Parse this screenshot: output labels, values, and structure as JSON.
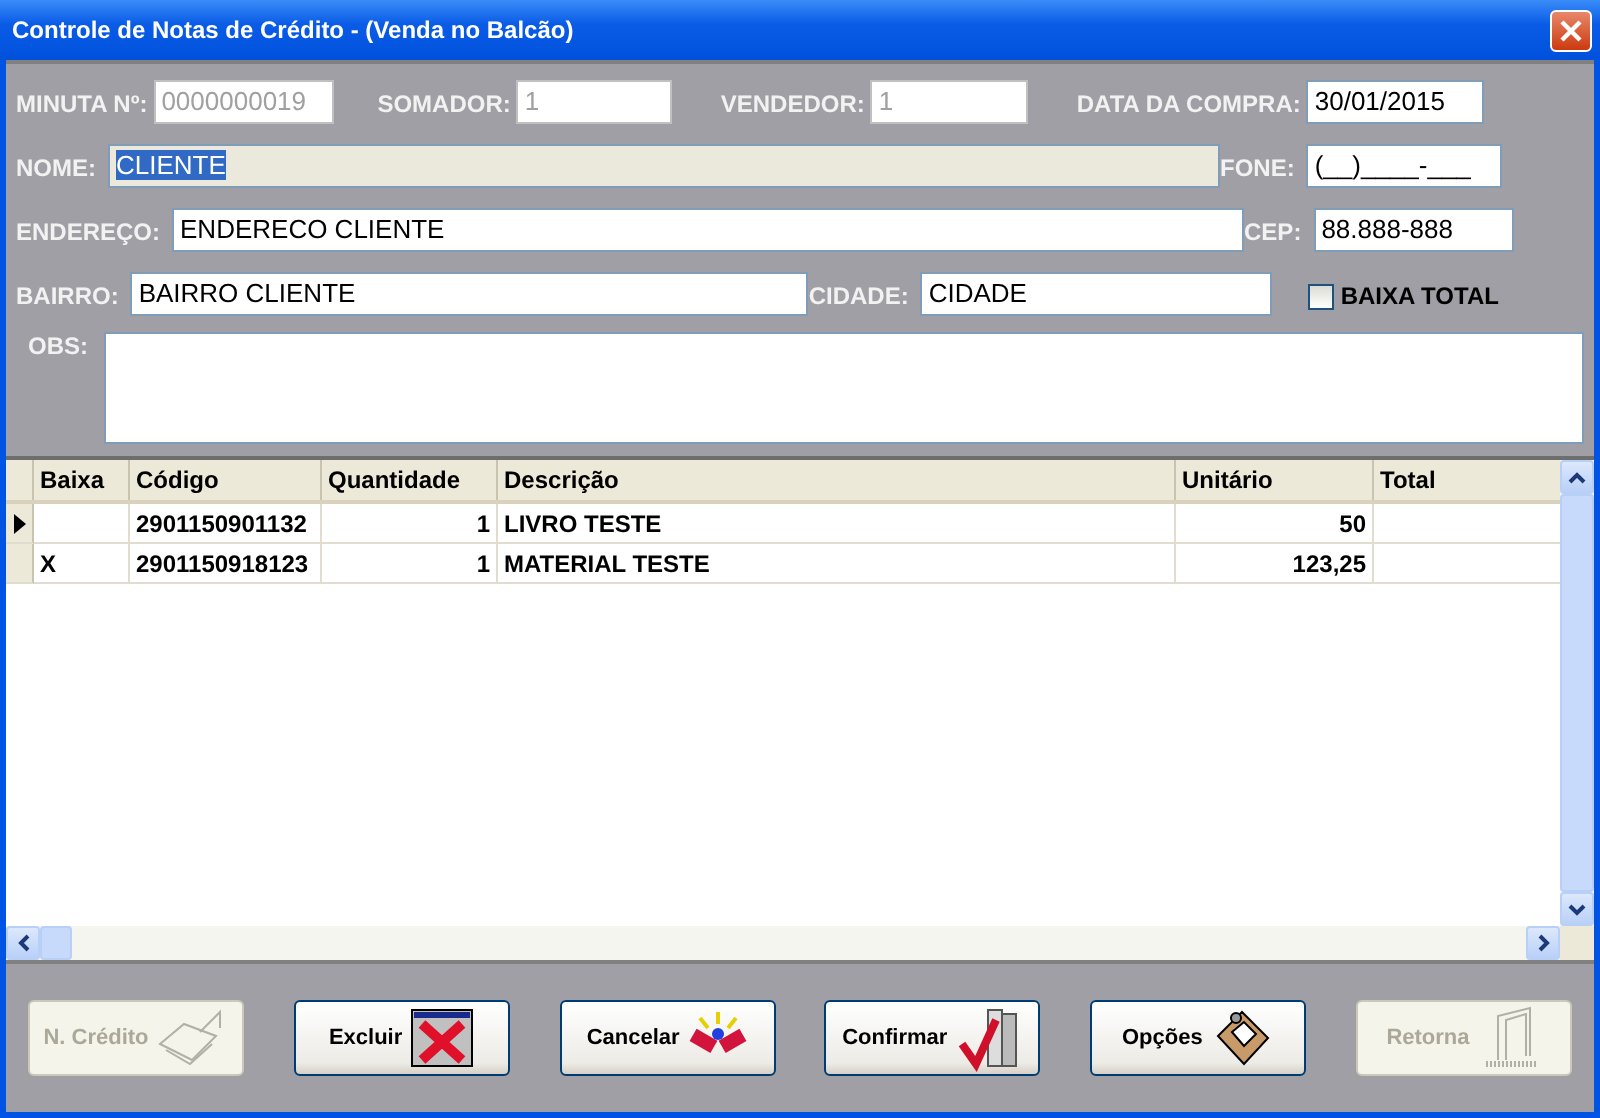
{
  "window": {
    "title": "Controle de Notas de Crédito - (Venda no Balcão)"
  },
  "form": {
    "fields": [
      {
        "label": "MINUTA Nº:",
        "value": "0000000019",
        "disabled": true
      },
      {
        "label": "SOMADOR:",
        "value": "1",
        "disabled": true
      },
      {
        "label": "VENDEDOR:",
        "value": "1",
        "disabled": true
      },
      {
        "label": "DATA DA COMPRA:",
        "value": "30/01/2015",
        "disabled": false
      },
      {
        "label": "NOME:",
        "value": "CLIENTE",
        "disabled": false,
        "readonly": true,
        "selected": true
      },
      {
        "label": "FONE:",
        "value": "(__)____-___",
        "disabled": false
      },
      {
        "label": "ENDEREÇO:",
        "value": "ENDERECO CLIENTE",
        "disabled": false
      },
      {
        "label": "CEP:",
        "value": "88.888-888",
        "disabled": false
      },
      {
        "label": "BAIRRO:",
        "value": "BAIRRO CLIENTE",
        "disabled": false
      },
      {
        "label": "CIDADE:",
        "value": "CIDADE",
        "disabled": false
      }
    ],
    "baixa_total": {
      "label": "BAIXA TOTAL",
      "checked": false
    },
    "obs": {
      "label": "OBS:"
    }
  },
  "table": {
    "columns": [
      "Baixa",
      "Código",
      "Quantidade",
      "Descrição",
      "Unitário",
      "Total"
    ],
    "rows": [
      {
        "current": true,
        "cells": [
          "",
          "2901150901132",
          "1",
          "LIVRO TESTE",
          "50",
          ""
        ]
      },
      {
        "current": false,
        "cells": [
          "X",
          "2901150918123",
          "1",
          "MATERIAL TESTE",
          "123,25",
          ""
        ]
      }
    ]
  },
  "buttons": [
    {
      "label": "N. Crédito",
      "disabled": true
    },
    {
      "label": "Excluir",
      "disabled": false
    },
    {
      "label": "Cancelar",
      "disabled": false
    },
    {
      "label": "Confirmar",
      "disabled": false
    },
    {
      "label": "Opções",
      "disabled": false
    },
    {
      "label": "Retorna",
      "disabled": true
    }
  ]
}
